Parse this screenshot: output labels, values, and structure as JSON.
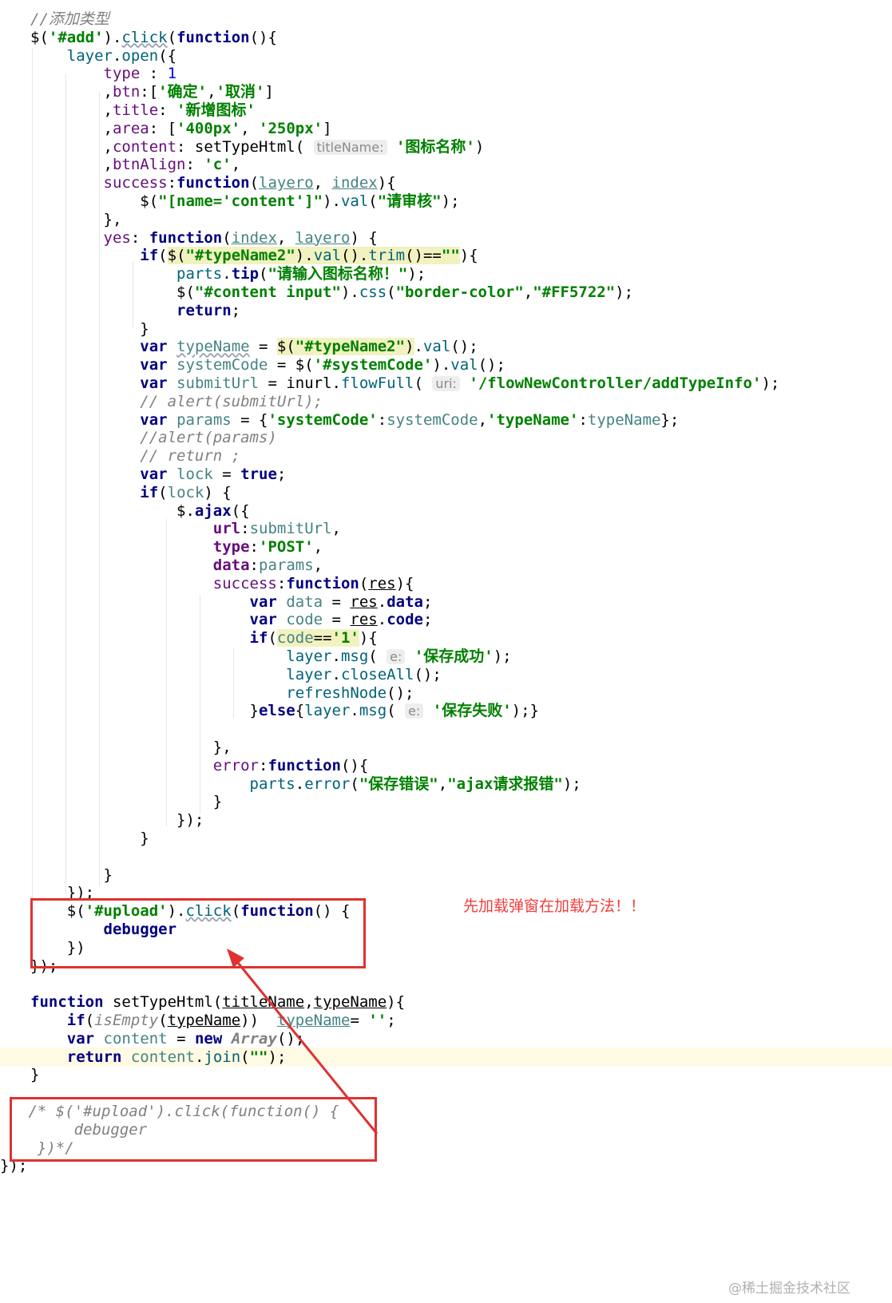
{
  "editor": {
    "lines": [
      [
        [
          "cm",
          "//添加类型"
        ]
      ],
      [
        [
          "",
          "$("
        ],
        [
          "str",
          "'#add'"
        ],
        [
          "",
          ")."
        ],
        [
          "sq fn",
          "click"
        ],
        [
          "",
          "("
        ],
        [
          "kw",
          "function"
        ],
        [
          "",
          "(){"
        ]
      ],
      [
        [
          "",
          "    "
        ],
        [
          "fn",
          "layer"
        ],
        [
          "",
          "."
        ],
        [
          "fn",
          "open"
        ],
        [
          "",
          "({"
        ]
      ],
      [
        [
          "",
          "        "
        ],
        [
          "prop",
          "type"
        ],
        [
          "",
          " : "
        ],
        [
          "num",
          "1"
        ]
      ],
      [
        [
          "",
          "        ,"
        ],
        [
          "prop",
          "btn"
        ],
        [
          "",
          ":["
        ],
        [
          "str",
          "'确定'"
        ],
        [
          "",
          ","
        ],
        [
          "str",
          "'取消'"
        ],
        [
          "",
          "]"
        ]
      ],
      [
        [
          "",
          "        ,"
        ],
        [
          "prop",
          "title"
        ],
        [
          "",
          ": "
        ],
        [
          "str",
          "'新增图标'"
        ]
      ],
      [
        [
          "",
          "        ,"
        ],
        [
          "prop",
          "area"
        ],
        [
          "",
          ": ["
        ],
        [
          "str",
          "'400px'"
        ],
        [
          "",
          ", "
        ],
        [
          "str",
          "'250px'"
        ],
        [
          "",
          "]"
        ]
      ],
      [
        [
          "",
          "        ,"
        ],
        [
          "prop",
          "content"
        ],
        [
          "",
          ": setTypeHtml( "
        ],
        [
          "hint",
          "titleName:"
        ],
        [
          "str",
          " '图标名称'"
        ],
        [
          "",
          ")"
        ]
      ],
      [
        [
          "",
          "        ,"
        ],
        [
          "prop",
          "btnAlign"
        ],
        [
          "",
          ": "
        ],
        [
          "str",
          "'c'"
        ],
        [
          "",
          ","
        ]
      ],
      [
        [
          "",
          "        "
        ],
        [
          "prop",
          "success"
        ],
        [
          "",
          ":"
        ],
        [
          "kw",
          "function"
        ],
        [
          "",
          "("
        ],
        [
          "ul var",
          "layero"
        ],
        [
          "",
          ", "
        ],
        [
          "ul var",
          "index"
        ],
        [
          "",
          "){"
        ]
      ],
      [
        [
          "",
          "            $("
        ],
        [
          "str",
          "\"[name='content']\""
        ],
        [
          "",
          ")."
        ],
        [
          "fn",
          "val"
        ],
        [
          "",
          "("
        ],
        [
          "str",
          "\"请审核\""
        ],
        [
          "",
          ");"
        ]
      ],
      [
        [
          "",
          "        },"
        ]
      ],
      [
        [
          "",
          "        "
        ],
        [
          "prop",
          "yes"
        ],
        [
          "",
          ": "
        ],
        [
          "kw",
          "function"
        ],
        [
          "",
          "("
        ],
        [
          "ul var",
          "index"
        ],
        [
          "",
          ", "
        ],
        [
          "ul var",
          "layero"
        ],
        [
          "",
          ") {"
        ]
      ],
      [
        [
          "",
          "            "
        ],
        [
          "kw",
          "if"
        ],
        [
          "",
          "("
        ],
        [
          "hl",
          "$("
        ],
        [
          "hl str",
          "\"#typeName2\""
        ],
        [
          "hl",
          ")."
        ],
        [
          "hl fn",
          "val"
        ],
        [
          "hl",
          "()."
        ],
        [
          "hl fn",
          "trim"
        ],
        [
          "hl",
          "()=="
        ],
        [
          "hl str",
          "\"\""
        ],
        [
          "",
          "){"
        ]
      ],
      [
        [
          "",
          "                "
        ],
        [
          "fn",
          "parts"
        ],
        [
          "",
          "."
        ],
        [
          "kw",
          "tip"
        ],
        [
          "",
          "("
        ],
        [
          "str",
          "\"请输入图标名称！\""
        ],
        [
          "",
          ");"
        ]
      ],
      [
        [
          "",
          "                $("
        ],
        [
          "str",
          "\"#content input\""
        ],
        [
          "",
          ")."
        ],
        [
          "fn",
          "css"
        ],
        [
          "",
          "("
        ],
        [
          "str",
          "\"border-color\""
        ],
        [
          "",
          ","
        ],
        [
          "str",
          "\"#FF5722\""
        ],
        [
          "",
          ");"
        ]
      ],
      [
        [
          "",
          "                "
        ],
        [
          "kw",
          "return"
        ],
        [
          "",
          ";"
        ]
      ],
      [
        [
          "",
          "            }"
        ]
      ],
      [
        [
          "",
          "            "
        ],
        [
          "kw",
          "var"
        ],
        [
          "",
          " "
        ],
        [
          "sq var",
          "typeName"
        ],
        [
          "",
          " = "
        ],
        [
          "hl",
          "$("
        ],
        [
          "hl str",
          "\"#typeName2\""
        ],
        [
          "hl",
          ")"
        ],
        [
          "",
          "."
        ],
        [
          "fn",
          "val"
        ],
        [
          "",
          "();"
        ]
      ],
      [
        [
          "",
          "            "
        ],
        [
          "kw",
          "var"
        ],
        [
          "",
          " "
        ],
        [
          "var",
          "systemCode"
        ],
        [
          "",
          " = $("
        ],
        [
          "str",
          "'#systemCode'"
        ],
        [
          "",
          ")."
        ],
        [
          "fn",
          "val"
        ],
        [
          "",
          "();"
        ]
      ],
      [
        [
          "",
          "            "
        ],
        [
          "kw",
          "var"
        ],
        [
          "",
          " "
        ],
        [
          "var",
          "submitUrl"
        ],
        [
          "",
          " = inurl."
        ],
        [
          "fn",
          "flowFull"
        ],
        [
          "",
          "( "
        ],
        [
          "hint",
          "uri:"
        ],
        [
          "str",
          " '/flowNewController/addTypeInfo'"
        ],
        [
          "",
          ");"
        ]
      ],
      [
        [
          "",
          "            "
        ],
        [
          "cm",
          "// alert(submitUrl);"
        ]
      ],
      [
        [
          "",
          "            "
        ],
        [
          "kw",
          "var"
        ],
        [
          "",
          " "
        ],
        [
          "var",
          "params"
        ],
        [
          "",
          " = {"
        ],
        [
          "str",
          "'systemCode'"
        ],
        [
          "",
          ":"
        ],
        [
          "var",
          "systemCode"
        ],
        [
          "",
          ","
        ],
        [
          "str",
          "'typeName'"
        ],
        [
          "",
          ":"
        ],
        [
          "var",
          "typeName"
        ],
        [
          "",
          "};"
        ]
      ],
      [
        [
          "",
          "            "
        ],
        [
          "cm",
          "//alert(params)"
        ]
      ],
      [
        [
          "",
          "            "
        ],
        [
          "cm",
          "// return ;"
        ]
      ],
      [
        [
          "",
          "            "
        ],
        [
          "kw",
          "var"
        ],
        [
          "",
          " "
        ],
        [
          "var",
          "lock"
        ],
        [
          "",
          " = "
        ],
        [
          "kw",
          "true"
        ],
        [
          "",
          ";"
        ]
      ],
      [
        [
          "",
          "            "
        ],
        [
          "kw",
          "if"
        ],
        [
          "",
          "("
        ],
        [
          "var",
          "lock"
        ],
        [
          "",
          ") {"
        ]
      ],
      [
        [
          "",
          "                $."
        ],
        [
          "kw",
          "ajax"
        ],
        [
          "",
          "({"
        ]
      ],
      [
        [
          "",
          "                    "
        ],
        [
          "prop kw",
          "url"
        ],
        [
          "",
          ":"
        ],
        [
          "var",
          "submitUrl"
        ],
        [
          "",
          ","
        ]
      ],
      [
        [
          "",
          "                    "
        ],
        [
          "prop kw",
          "type"
        ],
        [
          "",
          ":"
        ],
        [
          "str",
          "'POST'"
        ],
        [
          "",
          ","
        ]
      ],
      [
        [
          "",
          "                    "
        ],
        [
          "prop kw",
          "data"
        ],
        [
          "",
          ":"
        ],
        [
          "var",
          "params"
        ],
        [
          "",
          ","
        ]
      ],
      [
        [
          "",
          "                    "
        ],
        [
          "prop",
          "success"
        ],
        [
          "",
          ":"
        ],
        [
          "kw",
          "function"
        ],
        [
          "",
          "("
        ],
        [
          "ul",
          "res"
        ],
        [
          "",
          "){"
        ]
      ],
      [
        [
          "",
          "                        "
        ],
        [
          "kw",
          "var"
        ],
        [
          "",
          " "
        ],
        [
          "var",
          "data"
        ],
        [
          "",
          " = "
        ],
        [
          "ul",
          "res"
        ],
        [
          "",
          "."
        ],
        [
          "kw",
          "data"
        ],
        [
          "",
          ";"
        ]
      ],
      [
        [
          "",
          "                        "
        ],
        [
          "kw",
          "var"
        ],
        [
          "",
          " "
        ],
        [
          "var",
          "code"
        ],
        [
          "",
          " = "
        ],
        [
          "ul",
          "res"
        ],
        [
          "",
          "."
        ],
        [
          "kw",
          "code"
        ],
        [
          "",
          ";"
        ]
      ],
      [
        [
          "",
          "                        "
        ],
        [
          "kw",
          "if"
        ],
        [
          "",
          "("
        ],
        [
          "hl var",
          "code"
        ],
        [
          "hl",
          "=="
        ],
        [
          "hl str",
          "'1'"
        ],
        [
          "",
          "){"
        ]
      ],
      [
        [
          "",
          "                            "
        ],
        [
          "fn",
          "layer"
        ],
        [
          "",
          "."
        ],
        [
          "fn",
          "msg"
        ],
        [
          "",
          "( "
        ],
        [
          "hint",
          "e:"
        ],
        [
          "str",
          " '保存成功'"
        ],
        [
          "",
          ");"
        ]
      ],
      [
        [
          "",
          "                            "
        ],
        [
          "fn",
          "layer"
        ],
        [
          "",
          "."
        ],
        [
          "fn",
          "closeAll"
        ],
        [
          "",
          "();"
        ]
      ],
      [
        [
          "",
          "                            "
        ],
        [
          "fn",
          "refreshNode"
        ],
        [
          "",
          "();"
        ]
      ],
      [
        [
          "",
          "                        }"
        ],
        [
          "kw",
          "else"
        ],
        [
          "",
          "{"
        ],
        [
          "fn",
          "layer"
        ],
        [
          "",
          "."
        ],
        [
          "fn",
          "msg"
        ],
        [
          "",
          "( "
        ],
        [
          "hint",
          "e:"
        ],
        [
          "str",
          " '保存失败'"
        ],
        [
          "",
          ");}"
        ]
      ],
      [
        [
          "",
          ""
        ]
      ],
      [
        [
          "",
          "                    },"
        ]
      ],
      [
        [
          "",
          "                    "
        ],
        [
          "prop",
          "error"
        ],
        [
          "",
          ":"
        ],
        [
          "kw",
          "function"
        ],
        [
          "",
          "(){"
        ]
      ],
      [
        [
          "",
          "                        "
        ],
        [
          "fn",
          "parts"
        ],
        [
          "",
          "."
        ],
        [
          "fn",
          "error"
        ],
        [
          "",
          "("
        ],
        [
          "str",
          "\"保存错误\""
        ],
        [
          "",
          ","
        ],
        [
          "str",
          "\"ajax请求报错\""
        ],
        [
          "",
          ");"
        ]
      ],
      [
        [
          "",
          "                    }"
        ]
      ],
      [
        [
          "",
          "                });"
        ]
      ],
      [
        [
          "",
          "            }"
        ]
      ],
      [
        [
          "",
          ""
        ]
      ],
      [
        [
          "",
          "        }"
        ]
      ],
      [
        [
          "",
          "    });"
        ]
      ],
      [
        [
          "",
          "    $("
        ],
        [
          "str",
          "'#upload'"
        ],
        [
          "",
          ")."
        ],
        [
          "sq fn",
          "click"
        ],
        [
          "",
          "("
        ],
        [
          "kw",
          "function"
        ],
        [
          "",
          "() {"
        ]
      ],
      [
        [
          "",
          "        "
        ],
        [
          "kw",
          "debugger"
        ]
      ],
      [
        [
          "",
          "    })"
        ]
      ],
      [
        [
          "",
          "});"
        ]
      ],
      [
        [
          "",
          ""
        ]
      ],
      [
        [
          "",
          ""
        ],
        [
          "kw",
          "function"
        ],
        [
          "",
          " setTypeHtml("
        ],
        [
          "ul",
          "titleName"
        ],
        [
          "",
          ","
        ],
        [
          "ul",
          "typeName"
        ],
        [
          "",
          "){"
        ]
      ],
      [
        [
          "",
          "    "
        ],
        [
          "kw",
          "if"
        ],
        [
          "",
          "("
        ],
        [
          "cm",
          "isEmpty"
        ],
        [
          "",
          "("
        ],
        [
          "ul",
          "typeName"
        ],
        [
          "",
          "))  "
        ],
        [
          "ul var",
          "typeName"
        ],
        [
          "",
          "= "
        ],
        [
          "str",
          "''"
        ],
        [
          "",
          ";"
        ]
      ],
      [
        [
          "",
          "    "
        ],
        [
          "kw",
          "var"
        ],
        [
          "",
          " "
        ],
        [
          "var",
          "content"
        ],
        [
          "",
          " = "
        ],
        [
          "kw",
          "new"
        ],
        [
          "",
          " "
        ],
        [
          "kw cm",
          "Array"
        ],
        [
          "",
          "();"
        ]
      ],
      [
        [
          "",
          "    "
        ],
        [
          "kw",
          "return"
        ],
        [
          "",
          " "
        ],
        [
          "var",
          "content"
        ],
        [
          "",
          "."
        ],
        [
          "fn",
          "join"
        ],
        [
          "",
          "("
        ],
        [
          "str",
          "\"\""
        ],
        [
          "",
          ");"
        ]
      ],
      [
        [
          "",
          "}"
        ]
      ],
      [
        [
          "",
          ""
        ]
      ],
      [
        [
          "cm",
          " /* $('#upload').click(function() {"
        ]
      ],
      [
        [
          "cm",
          "      debugger"
        ]
      ],
      [
        [
          "cm",
          "  })*/"
        ]
      ],
      [
        [
          "",
          "});"
        ]
      ]
    ],
    "current_line_index": 57
  },
  "annotation": {
    "note": "先加载弹窗在加载方法！！",
    "color": "#e03131"
  },
  "watermark": "@稀土掘金技术社区"
}
